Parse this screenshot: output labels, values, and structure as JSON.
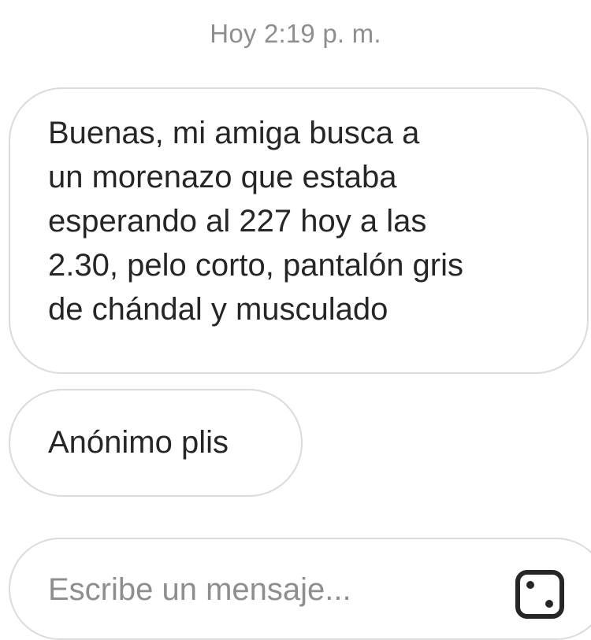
{
  "thread": {
    "timestamp": "Hoy 2:19 p. m.",
    "messages": [
      {
        "lines": [
          "Buenas, mi amiga busca a",
          "un morenazo que estaba",
          "esperando al 227 hoy a las",
          "2.30, pelo corto, pantalón gris",
          "de chándal y musculado"
        ]
      },
      {
        "text": "Anónimo plis"
      }
    ]
  },
  "composer": {
    "placeholder": "Escribe un mensaje..."
  },
  "icons": {
    "composer_action": "gallery-icon"
  },
  "colors": {
    "text": "#262626",
    "muted": "#8e8e8e",
    "border": "#dbdbdb",
    "background": "#ffffff"
  }
}
